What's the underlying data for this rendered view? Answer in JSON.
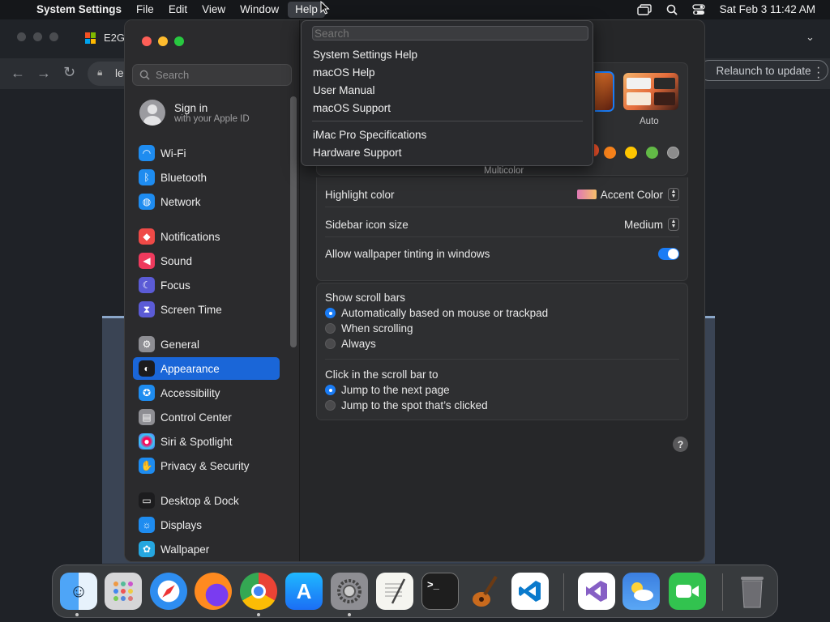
{
  "menubar": {
    "app_name": "System Settings",
    "menus": [
      "File",
      "Edit",
      "View",
      "Window",
      "Help"
    ],
    "datetime": "Sat Feb 3  11:42 AM"
  },
  "browser": {
    "tab_title": "E2G",
    "url_fragment": "le",
    "relaunch_label": "Relaunch to update"
  },
  "sidebar": {
    "search_placeholder": "Search",
    "signin_title": "Sign in",
    "signin_subtitle": "with your Apple ID",
    "items": [
      {
        "label": "Wi-Fi",
        "icon": "wifi-icon",
        "color": "#1e8cf0"
      },
      {
        "label": "Bluetooth",
        "icon": "bluetooth-icon",
        "color": "#1e8cf0"
      },
      {
        "label": "Network",
        "icon": "globe-icon",
        "color": "#1e8cf0"
      },
      {
        "label": "Notifications",
        "icon": "bell-icon",
        "color": "#ef4a47"
      },
      {
        "label": "Sound",
        "icon": "speaker-icon",
        "color": "#ef3a5d"
      },
      {
        "label": "Focus",
        "icon": "moon-icon",
        "color": "#5b5bd6"
      },
      {
        "label": "Screen Time",
        "icon": "hourglass-icon",
        "color": "#5b5bd6"
      },
      {
        "label": "General",
        "icon": "gear-icon",
        "color": "#8e8e93"
      },
      {
        "label": "Appearance",
        "icon": "appearance-icon",
        "color": "#1c1c1e"
      },
      {
        "label": "Accessibility",
        "icon": "accessibility-icon",
        "color": "#1e8cf0"
      },
      {
        "label": "Control Center",
        "icon": "control-center-icon",
        "color": "#8e8e93"
      },
      {
        "label": "Siri & Spotlight",
        "icon": "siri-icon",
        "color": "#7a3fd1"
      },
      {
        "label": "Privacy & Security",
        "icon": "hand-icon",
        "color": "#1e8cf0"
      },
      {
        "label": "Desktop & Dock",
        "icon": "dock-icon",
        "color": "#1c1c1e"
      },
      {
        "label": "Displays",
        "icon": "sun-icon",
        "color": "#1e8cf0"
      },
      {
        "label": "Wallpaper",
        "icon": "wallpaper-icon",
        "color": "#25a7e0"
      }
    ],
    "selected": "Appearance"
  },
  "appearance": {
    "auto_label": "Auto",
    "multicolor_label": "Multicolor",
    "accent_colors": [
      "#f7821b",
      "#ffc600",
      "#62ba46",
      "#8c8c8c"
    ],
    "highlight_label": "Highlight color",
    "highlight_value": "Accent Color",
    "icon_size_label": "Sidebar icon size",
    "icon_size_value": "Medium",
    "tinting_label": "Allow wallpaper tinting in windows",
    "tinting_on": true,
    "scrollbars_title": "Show scroll bars",
    "scrollbar_options": [
      "Automatically based on mouse or trackpad",
      "When scrolling",
      "Always"
    ],
    "scrollbar_selected": 0,
    "click_title": "Click in the scroll bar to",
    "click_options": [
      "Jump to the next page",
      "Jump to the spot that’s clicked"
    ],
    "click_selected": 0,
    "help_button": "?"
  },
  "help_menu": {
    "search_placeholder": "Search",
    "items": [
      "System Settings Help",
      "macOS Help",
      "User Manual",
      "macOS Support"
    ],
    "items2": [
      "iMac Pro Specifications",
      "Hardware Support"
    ]
  },
  "dock": {
    "apps": [
      "Finder",
      "Launchpad",
      "Safari",
      "Firefox",
      "Chrome",
      "App Store",
      "System Settings",
      "TextEdit",
      "Terminal",
      "GarageBand",
      "VS Code",
      "Visual Studio",
      "Weather",
      "FaceTime",
      "Trash"
    ],
    "running": [
      "Finder",
      "Chrome",
      "System Settings"
    ]
  }
}
